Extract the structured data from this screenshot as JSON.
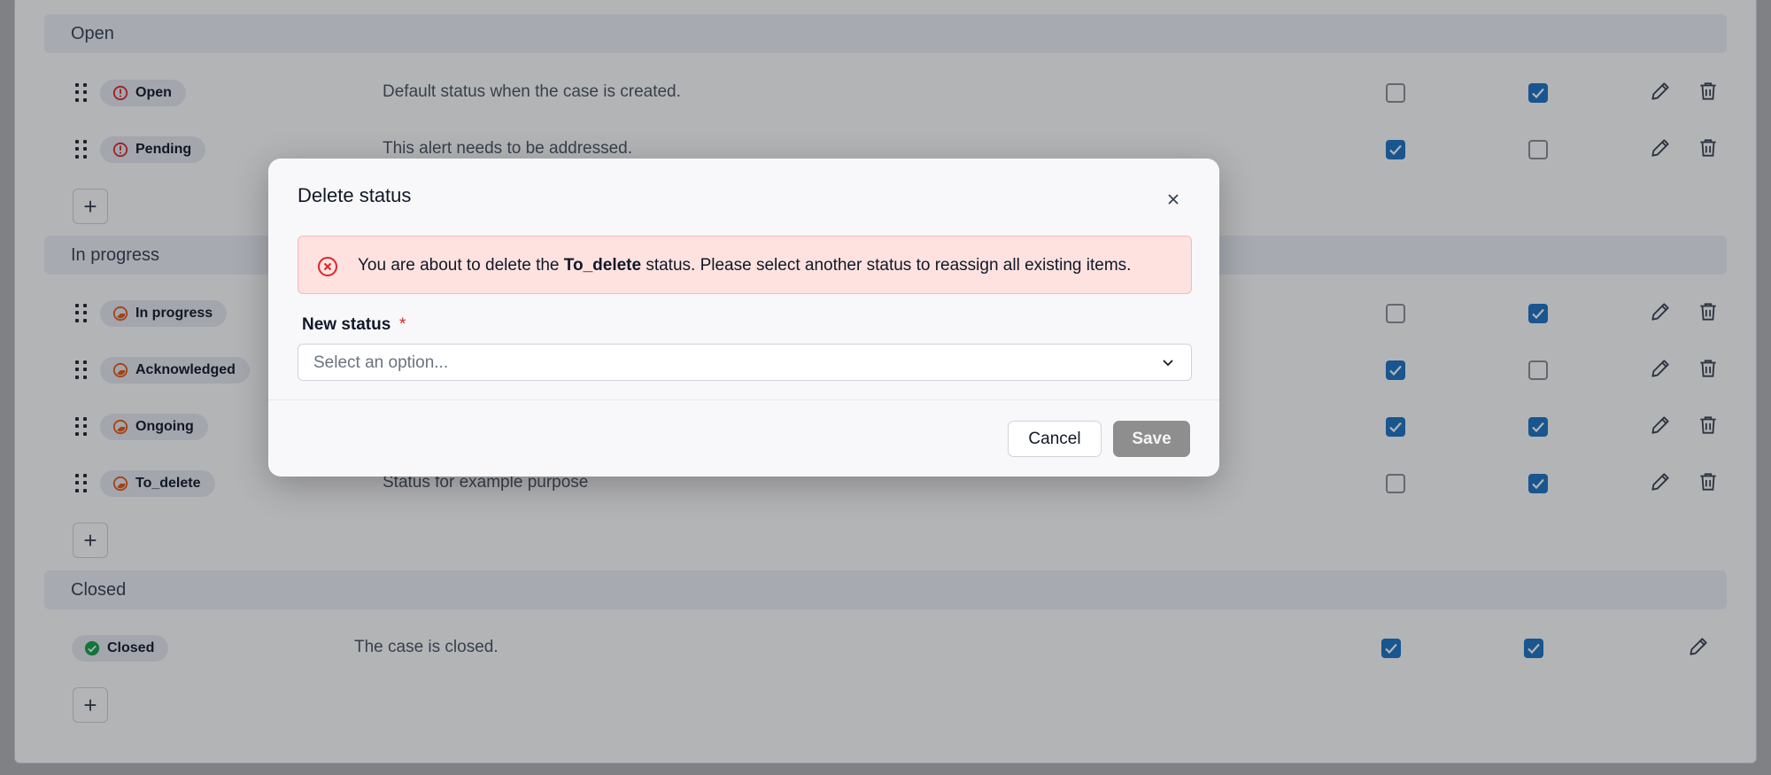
{
  "groups": {
    "open": {
      "title": "Open",
      "rows": [
        {
          "name": "Open",
          "icon": "alert-circle-icon",
          "description": "Default status when the case is created.",
          "check_a": false,
          "check_b": true
        },
        {
          "name": "Pending",
          "icon": "alert-circle-icon",
          "description": "This alert needs to be addressed.",
          "check_a": true,
          "check_b": false
        }
      ]
    },
    "in_progress": {
      "title": "In progress",
      "rows": [
        {
          "name": "In progress",
          "icon": "progress-icon",
          "description": "",
          "check_a": false,
          "check_b": true
        },
        {
          "name": "Acknowledged",
          "icon": "progress-icon",
          "description": "",
          "check_a": true,
          "check_b": false
        },
        {
          "name": "Ongoing",
          "icon": "progress-icon",
          "description": "",
          "check_a": true,
          "check_b": true
        },
        {
          "name": "To_delete",
          "icon": "progress-icon",
          "description": "Status for example purpose",
          "check_a": false,
          "check_b": true
        }
      ]
    },
    "closed": {
      "title": "Closed",
      "rows": [
        {
          "name": "Closed",
          "icon": "check-circle-icon",
          "description": "The case is closed.",
          "check_a": true,
          "check_b": true
        }
      ]
    }
  },
  "add_button_label": "+",
  "modal": {
    "title": "Delete status",
    "alert_prefix": "You are about to delete the ",
    "alert_status": "To_delete",
    "alert_suffix": " status. Please select another status to reassign all existing items.",
    "field_label": "New status",
    "required_mark": "*",
    "select_placeholder": "Select an option...",
    "cancel_label": "Cancel",
    "save_label": "Save"
  },
  "colors": {
    "accent": "#1d74c4",
    "open_icon": "#dc2626",
    "progress_icon": "#ea580c",
    "closed_icon": "#16a34a",
    "save_disabled": "#8e8e8e",
    "alert_bg": "#fde2e0"
  }
}
